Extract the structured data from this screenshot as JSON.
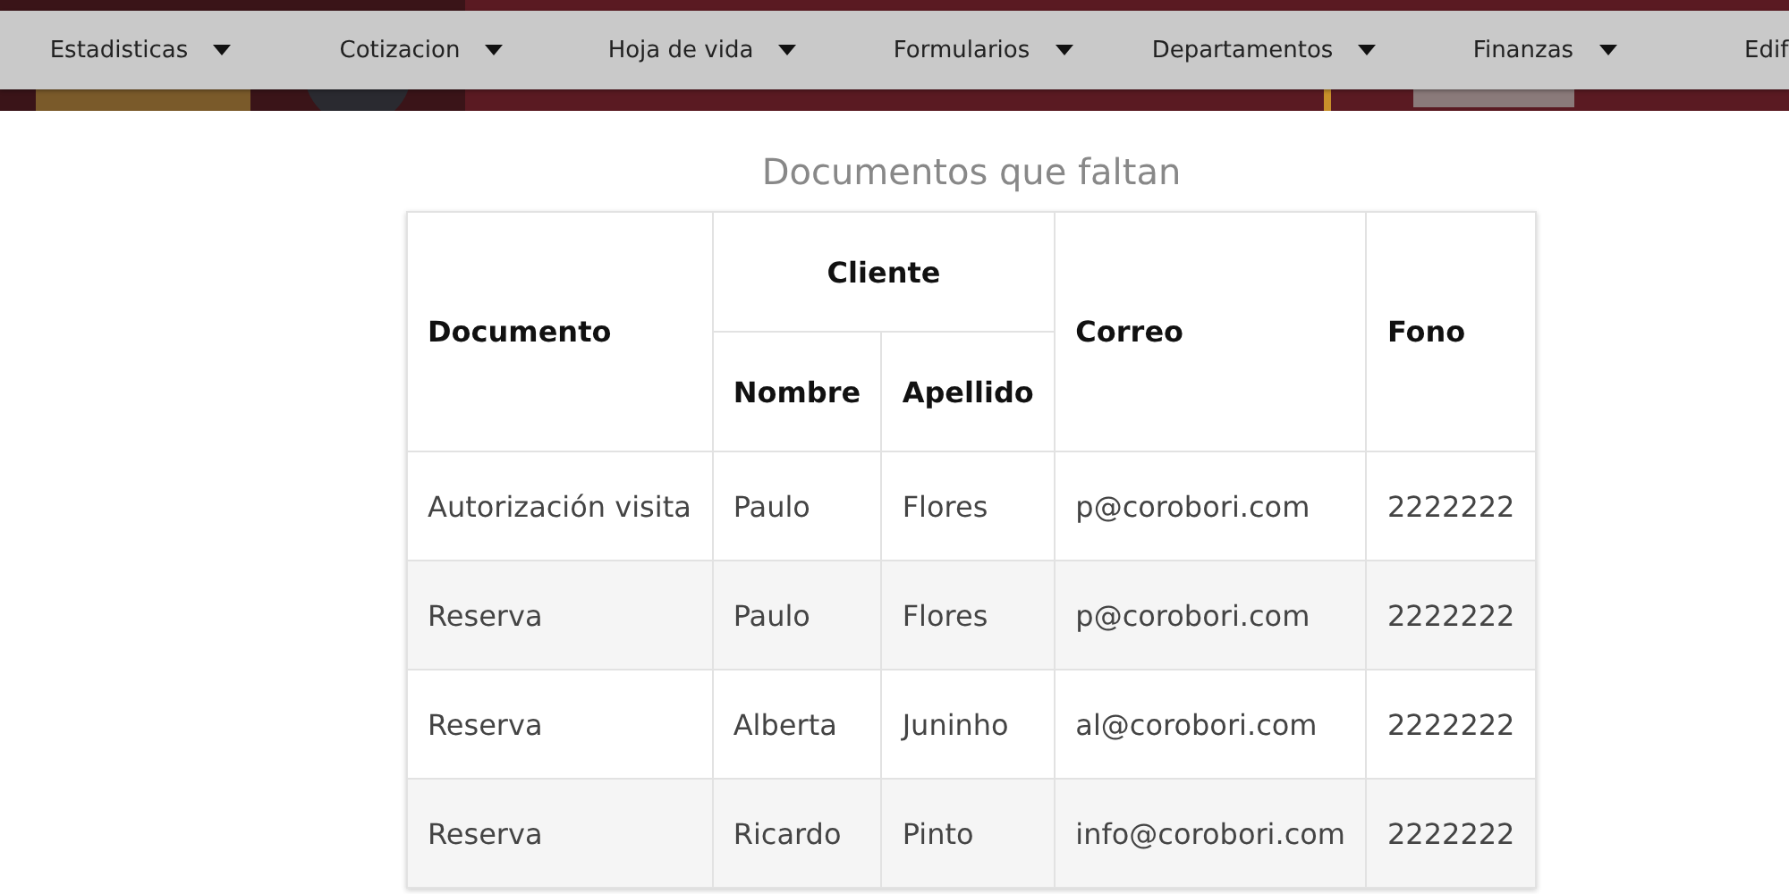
{
  "menu": [
    {
      "label": "Estadisticas"
    },
    {
      "label": "Cotizacion"
    },
    {
      "label": "Hoja de vida"
    },
    {
      "label": "Formularios"
    },
    {
      "label": "Departamentos"
    },
    {
      "label": "Finanzas"
    },
    {
      "label": "Edif"
    }
  ],
  "title": "Documentos que faltan",
  "table": {
    "group_heading": "Cliente",
    "columns": [
      "Documento",
      "Nombre",
      "Apellido",
      "Correo",
      "Fono"
    ],
    "rows": [
      [
        "Autorización visita",
        "Paulo",
        "Flores",
        "p@corobori.com",
        "2222222"
      ],
      [
        "Reserva",
        "Paulo",
        "Flores",
        "p@corobori.com",
        "2222222"
      ],
      [
        "Reserva",
        "Alberta",
        "Juninho",
        "al@corobori.com",
        "2222222"
      ],
      [
        "Reserva",
        "Ricardo",
        "Pinto",
        "info@corobori.com",
        "2222222"
      ]
    ]
  }
}
